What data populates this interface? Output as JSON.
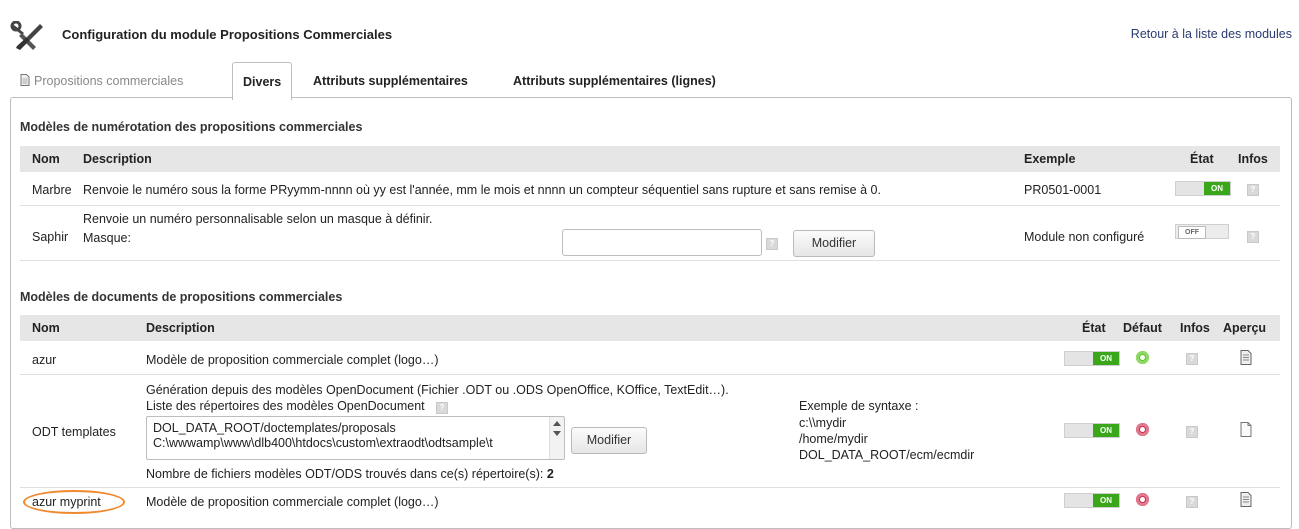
{
  "header": {
    "title": "Configuration du module Propositions Commerciales",
    "back_link": "Retour à la liste des modules"
  },
  "tabs": [
    {
      "label": "Propositions commerciales",
      "icon": "document-icon",
      "state": "inactive"
    },
    {
      "label": "Divers",
      "state": "active"
    },
    {
      "label": "Attributs supplémentaires",
      "state": "normal"
    },
    {
      "label": "Attributs supplémentaires (lignes)",
      "state": "normal"
    }
  ],
  "numbering": {
    "title": "Modèles de numérotation des propositions commerciales",
    "columns": {
      "nom": "Nom",
      "description": "Description",
      "exemple": "Exemple",
      "etat": "État",
      "infos": "Infos"
    },
    "rows": [
      {
        "name": "Marbre",
        "description": "Renvoie le numéro sous la forme PRyymm-nnnn où yy est l'année, mm le mois et nnnn un compteur séquentiel sans rupture et sans remise à 0.",
        "example": "PR0501-0001",
        "state": "ON"
      },
      {
        "name": "Saphir",
        "description": "Renvoie un numéro personnalisable selon un masque à définir.",
        "mask_label": "Masque:",
        "mask_value": "",
        "button": "Modifier",
        "example": "Module non configuré",
        "state": "OFF"
      }
    ]
  },
  "documents": {
    "title": "Modèles de documents de propositions commerciales",
    "columns": {
      "nom": "Nom",
      "description": "Description",
      "etat": "État",
      "defaut": "Défaut",
      "infos": "Infos",
      "apercu": "Aperçu"
    },
    "rows": [
      {
        "name": "azur",
        "description": "Modèle de proposition commerciale complet (logo…)",
        "state": "ON",
        "default": true
      },
      {
        "name": "ODT templates",
        "description_line1": "Génération depuis des modèles OpenDocument (Fichier .ODT ou .ODS OpenOffice, KOffice, TextEdit…).",
        "description_line2": "Liste des répertoires des modèles OpenDocument",
        "textarea_line1": "DOL_DATA_ROOT/doctemplates/proposals",
        "textarea_line2": "C:\\wwwamp\\www\\dlb400\\htdocs\\custom\\extraodt\\odtsample\\t",
        "button": "Modifier",
        "syntax_title": "Exemple de syntaxe :",
        "syntax_lines": [
          "c:\\\\mydir",
          "/home/mydir",
          "DOL_DATA_ROOT/ecm/ecmdir"
        ],
        "found_label": "Nombre de fichiers modèles ODT/ODS trouvés dans ce(s) répertoire(s):",
        "found_count": "2",
        "state": "ON",
        "default": false
      },
      {
        "name": "azur myprint",
        "description": "Modèle de proposition commerciale complet (logo…)",
        "state": "ON",
        "default": false
      }
    ]
  },
  "toggle_labels": {
    "on": "ON",
    "off": "OFF"
  },
  "colors": {
    "toggle_on": "#3aa71b",
    "default_on": "#5fbf30",
    "default_off": "#c4304f",
    "link": "#2a3b73",
    "highlight": "#f0882e"
  }
}
